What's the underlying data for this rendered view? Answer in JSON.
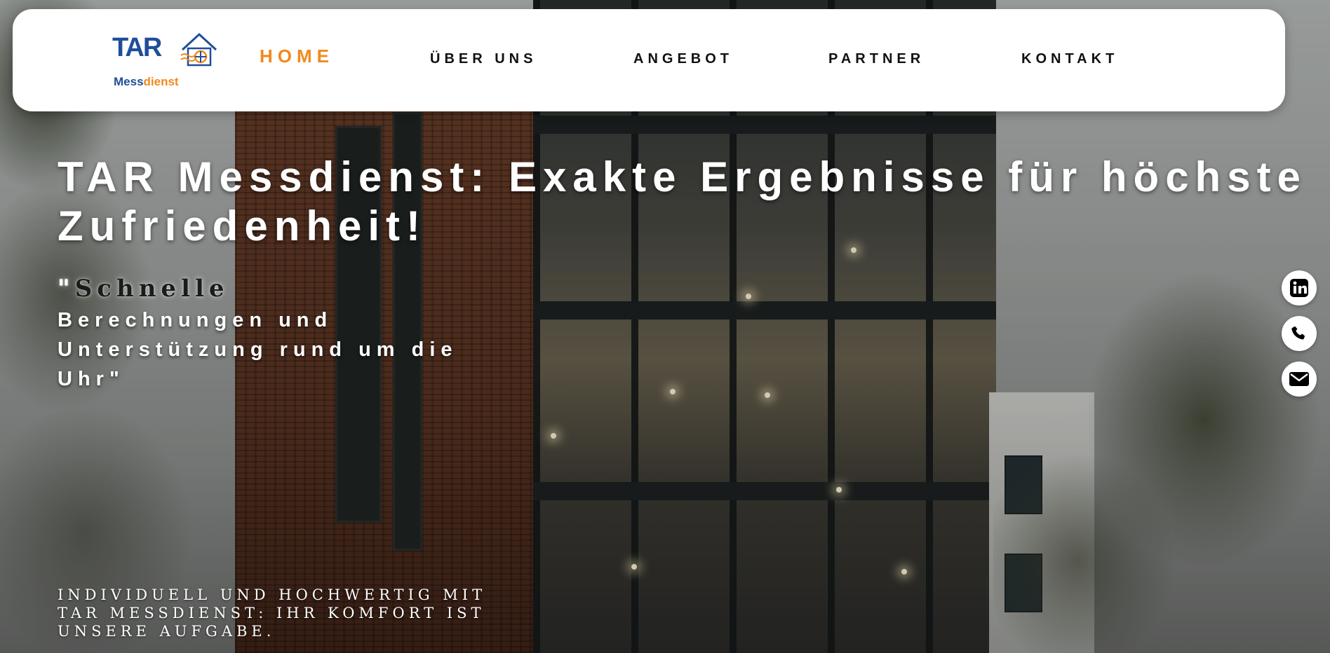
{
  "colors": {
    "accent": "#f08a1c",
    "brand_blue": "#1f4e9a",
    "nav_text": "#111111",
    "header_bg": "#ffffff",
    "hero_text": "#ffffff"
  },
  "logo": {
    "brand_part1": "TAR",
    "brand_sub_part1": "Mess",
    "brand_sub_part2": "dienst",
    "icon": "house-icon"
  },
  "nav": {
    "items": [
      {
        "label": "HOME",
        "active": true
      },
      {
        "label": "ÜBER UNS",
        "active": false
      },
      {
        "label": "ANGEBOT",
        "active": false
      },
      {
        "label": "PARTNER",
        "active": false
      },
      {
        "label": "KONTAKT",
        "active": false
      }
    ]
  },
  "hero": {
    "title": "TAR Messdienst: Exakte Ergebnisse für höchste Zufriedenheit!",
    "quote_open": "\"",
    "quote_first_word": "Schnelle",
    "quote_rest": "Berechnungen und Unterstützung rund um die Uhr\"",
    "tagline": "INDIVIDUELL UND HOCHWERTIG MIT TAR MESSDIENST: IHR KOMFORT IST UNSERE AUFGABE."
  },
  "social": {
    "items": [
      {
        "icon": "linkedin-icon"
      },
      {
        "icon": "phone-icon"
      },
      {
        "icon": "mail-icon"
      }
    ]
  }
}
